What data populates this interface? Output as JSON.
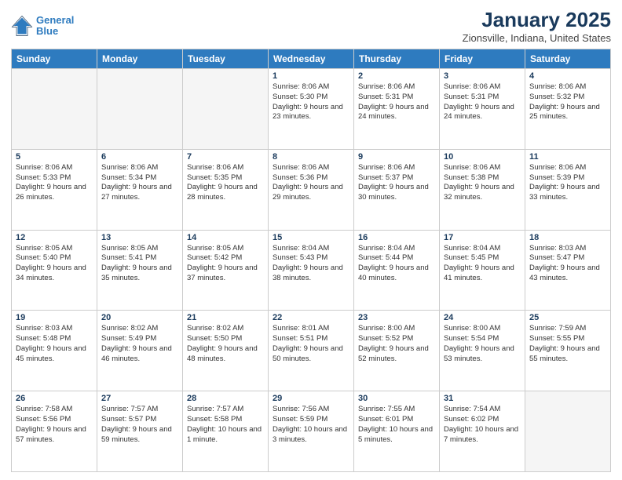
{
  "header": {
    "logo_line1": "General",
    "logo_line2": "Blue",
    "title": "January 2025",
    "subtitle": "Zionsville, Indiana, United States"
  },
  "days_of_week": [
    "Sunday",
    "Monday",
    "Tuesday",
    "Wednesday",
    "Thursday",
    "Friday",
    "Saturday"
  ],
  "weeks": [
    [
      {
        "day": "",
        "empty": true
      },
      {
        "day": "",
        "empty": true
      },
      {
        "day": "",
        "empty": true
      },
      {
        "day": "1",
        "sunrise": "8:06 AM",
        "sunset": "5:30 PM",
        "daylight": "9 hours and 23 minutes."
      },
      {
        "day": "2",
        "sunrise": "8:06 AM",
        "sunset": "5:31 PM",
        "daylight": "9 hours and 24 minutes."
      },
      {
        "day": "3",
        "sunrise": "8:06 AM",
        "sunset": "5:31 PM",
        "daylight": "9 hours and 24 minutes."
      },
      {
        "day": "4",
        "sunrise": "8:06 AM",
        "sunset": "5:32 PM",
        "daylight": "9 hours and 25 minutes."
      }
    ],
    [
      {
        "day": "5",
        "sunrise": "8:06 AM",
        "sunset": "5:33 PM",
        "daylight": "9 hours and 26 minutes."
      },
      {
        "day": "6",
        "sunrise": "8:06 AM",
        "sunset": "5:34 PM",
        "daylight": "9 hours and 27 minutes."
      },
      {
        "day": "7",
        "sunrise": "8:06 AM",
        "sunset": "5:35 PM",
        "daylight": "9 hours and 28 minutes."
      },
      {
        "day": "8",
        "sunrise": "8:06 AM",
        "sunset": "5:36 PM",
        "daylight": "9 hours and 29 minutes."
      },
      {
        "day": "9",
        "sunrise": "8:06 AM",
        "sunset": "5:37 PM",
        "daylight": "9 hours and 30 minutes."
      },
      {
        "day": "10",
        "sunrise": "8:06 AM",
        "sunset": "5:38 PM",
        "daylight": "9 hours and 32 minutes."
      },
      {
        "day": "11",
        "sunrise": "8:06 AM",
        "sunset": "5:39 PM",
        "daylight": "9 hours and 33 minutes."
      }
    ],
    [
      {
        "day": "12",
        "sunrise": "8:05 AM",
        "sunset": "5:40 PM",
        "daylight": "9 hours and 34 minutes."
      },
      {
        "day": "13",
        "sunrise": "8:05 AM",
        "sunset": "5:41 PM",
        "daylight": "9 hours and 35 minutes."
      },
      {
        "day": "14",
        "sunrise": "8:05 AM",
        "sunset": "5:42 PM",
        "daylight": "9 hours and 37 minutes."
      },
      {
        "day": "15",
        "sunrise": "8:04 AM",
        "sunset": "5:43 PM",
        "daylight": "9 hours and 38 minutes."
      },
      {
        "day": "16",
        "sunrise": "8:04 AM",
        "sunset": "5:44 PM",
        "daylight": "9 hours and 40 minutes."
      },
      {
        "day": "17",
        "sunrise": "8:04 AM",
        "sunset": "5:45 PM",
        "daylight": "9 hours and 41 minutes."
      },
      {
        "day": "18",
        "sunrise": "8:03 AM",
        "sunset": "5:47 PM",
        "daylight": "9 hours and 43 minutes."
      }
    ],
    [
      {
        "day": "19",
        "sunrise": "8:03 AM",
        "sunset": "5:48 PM",
        "daylight": "9 hours and 45 minutes."
      },
      {
        "day": "20",
        "sunrise": "8:02 AM",
        "sunset": "5:49 PM",
        "daylight": "9 hours and 46 minutes."
      },
      {
        "day": "21",
        "sunrise": "8:02 AM",
        "sunset": "5:50 PM",
        "daylight": "9 hours and 48 minutes."
      },
      {
        "day": "22",
        "sunrise": "8:01 AM",
        "sunset": "5:51 PM",
        "daylight": "9 hours and 50 minutes."
      },
      {
        "day": "23",
        "sunrise": "8:00 AM",
        "sunset": "5:52 PM",
        "daylight": "9 hours and 52 minutes."
      },
      {
        "day": "24",
        "sunrise": "8:00 AM",
        "sunset": "5:54 PM",
        "daylight": "9 hours and 53 minutes."
      },
      {
        "day": "25",
        "sunrise": "7:59 AM",
        "sunset": "5:55 PM",
        "daylight": "9 hours and 55 minutes."
      }
    ],
    [
      {
        "day": "26",
        "sunrise": "7:58 AM",
        "sunset": "5:56 PM",
        "daylight": "9 hours and 57 minutes."
      },
      {
        "day": "27",
        "sunrise": "7:57 AM",
        "sunset": "5:57 PM",
        "daylight": "9 hours and 59 minutes."
      },
      {
        "day": "28",
        "sunrise": "7:57 AM",
        "sunset": "5:58 PM",
        "daylight": "10 hours and 1 minute."
      },
      {
        "day": "29",
        "sunrise": "7:56 AM",
        "sunset": "5:59 PM",
        "daylight": "10 hours and 3 minutes."
      },
      {
        "day": "30",
        "sunrise": "7:55 AM",
        "sunset": "6:01 PM",
        "daylight": "10 hours and 5 minutes."
      },
      {
        "day": "31",
        "sunrise": "7:54 AM",
        "sunset": "6:02 PM",
        "daylight": "10 hours and 7 minutes."
      },
      {
        "day": "",
        "empty": true
      }
    ]
  ]
}
